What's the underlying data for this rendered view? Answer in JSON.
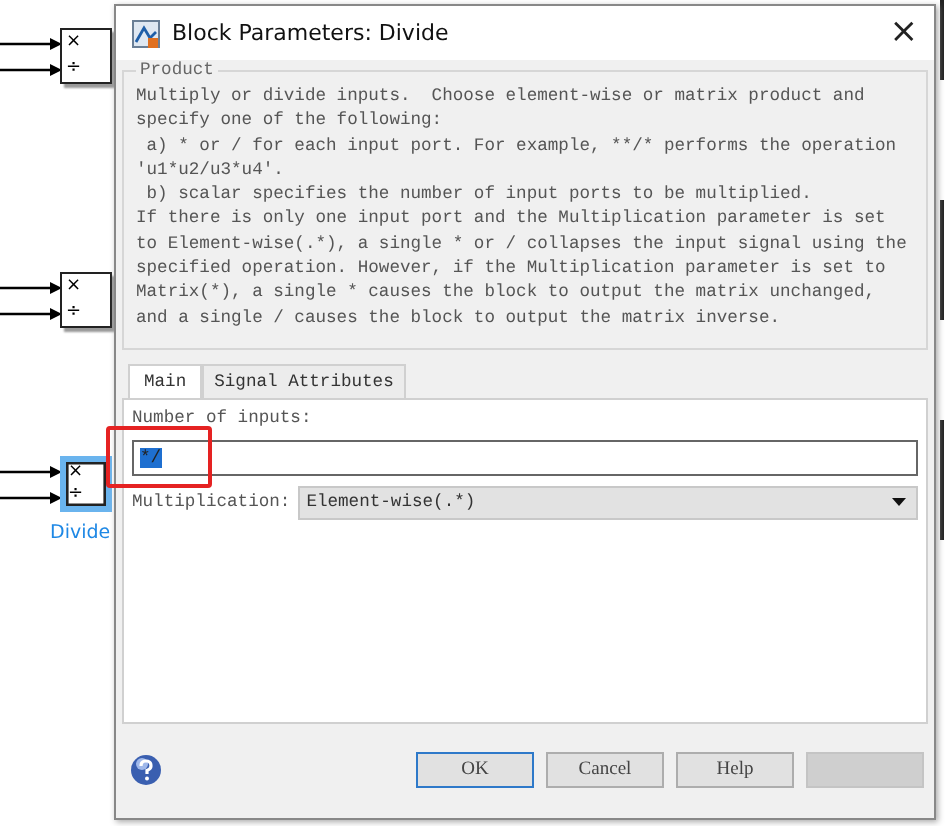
{
  "canvas": {
    "blocks": [
      {
        "top_symbol": "×",
        "bottom_symbol": "÷",
        "selected": false
      },
      {
        "top_symbol": "×",
        "bottom_symbol": "÷",
        "selected": false
      },
      {
        "top_symbol": "×",
        "bottom_symbol": "÷",
        "selected": true,
        "label": "Divide"
      }
    ]
  },
  "window": {
    "title": "Block Parameters: Divide",
    "close": "×"
  },
  "group": {
    "title": "Product",
    "description_lines": [
      "Multiply or divide inputs.  Choose element-wise or matrix product and",
      "specify one of the following:",
      " a) * or / for each input port. For example, **/* performs the operation",
      "'u1*u2/u3*u4'.",
      " b) scalar specifies the number of input ports to be multiplied.",
      "If there is only one input port and the Multiplication parameter is set",
      "to Element-wise(.*), a single * or / collapses the input signal using the",
      "specified operation. However, if the Multiplication parameter is set to",
      "Matrix(*), a single * causes the block to output the matrix unchanged,",
      "and a single / causes the block to output the matrix inverse."
    ]
  },
  "tabs": [
    {
      "label": "Main",
      "selected": true
    },
    {
      "label": "Signal Attributes",
      "selected": false
    }
  ],
  "number_of_inputs": {
    "label": "Number of inputs:",
    "value": "*/",
    "highlighted": true
  },
  "multiplication": {
    "label": "Multiplication:",
    "value": "Element-wise(.*)"
  },
  "buttons": [
    {
      "label": "OK",
      "disabled": false,
      "default": true
    },
    {
      "label": "Cancel",
      "disabled": false,
      "default": false
    },
    {
      "label": "Help",
      "disabled": false,
      "default": false
    },
    {
      "disabled": true,
      "default": false
    }
  ]
}
